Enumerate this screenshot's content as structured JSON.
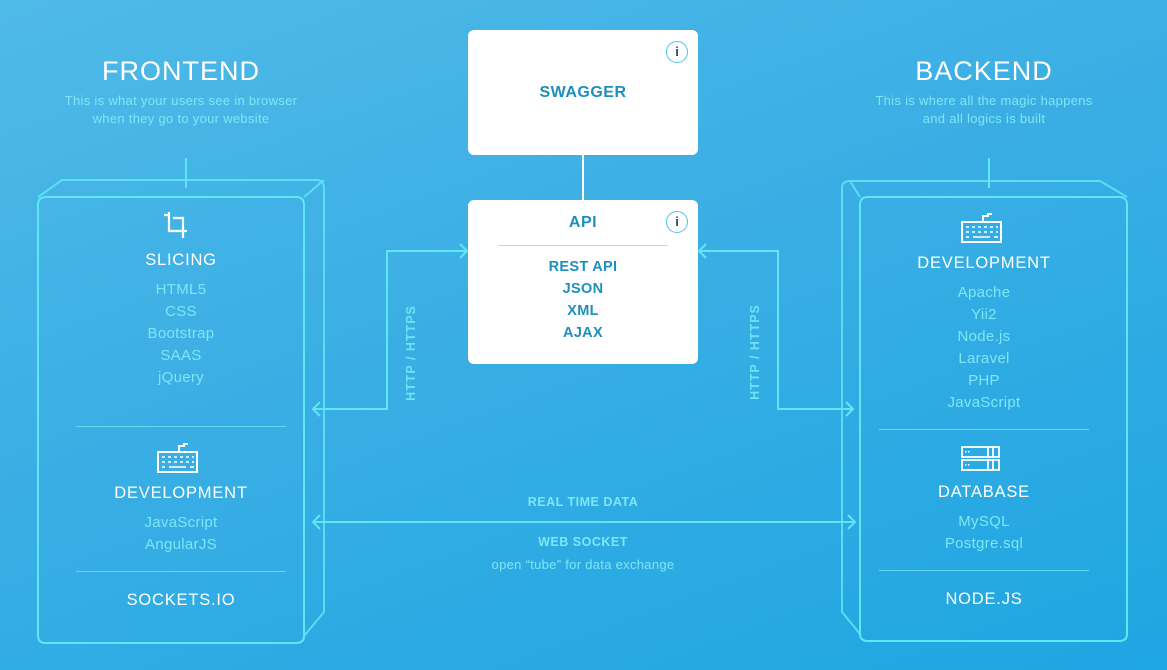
{
  "frontend": {
    "title": "FRONTEND",
    "subtitle_line1": "This is what your users see in browser",
    "subtitle_line2": "when they go to your website",
    "sections": [
      {
        "icon": "crop-icon",
        "title": "SLICING",
        "items": [
          "HTML5",
          "CSS",
          "Bootstrap",
          "SAAS",
          "jQuery"
        ]
      },
      {
        "icon": "keyboard-icon",
        "title": "DEVELOPMENT",
        "items": [
          "JavaScript",
          "AngularJS"
        ]
      },
      {
        "title": "SOCKETS.IO",
        "items": []
      }
    ]
  },
  "backend": {
    "title": "BACKEND",
    "subtitle_line1": "This is where all the magic happens",
    "subtitle_line2": "and all logics is built",
    "sections": [
      {
        "icon": "keyboard-icon",
        "title": "DEVELOPMENT",
        "items": [
          "Apache",
          "Yii2",
          "Node.js",
          "Laravel",
          "PHP",
          "JavaScript"
        ]
      },
      {
        "icon": "server-icon",
        "title": "DATABASE",
        "items": [
          "MySQL",
          "Postgre.sql"
        ]
      },
      {
        "title": "NODE.JS",
        "items": []
      }
    ]
  },
  "swagger": {
    "title": "SWAGGER",
    "info_label": "i"
  },
  "api": {
    "title": "API",
    "info_label": "i",
    "items": [
      "REST API",
      "JSON",
      "XML",
      "AJAX"
    ]
  },
  "connections": {
    "left_http": "HTTP / HTTPS",
    "right_http": "HTTP / HTTPS",
    "realtime_label": "REAL TIME DATA",
    "websocket_label": "WEB SOCKET",
    "websocket_desc": "open “tube” for data exchange"
  },
  "colors": {
    "accent_line": "#5fe6f7",
    "card_text": "#1e8fbd",
    "item_text": "#7ee7f5",
    "background_top": "#4fbae8",
    "background_bottom": "#1ea6e2"
  }
}
